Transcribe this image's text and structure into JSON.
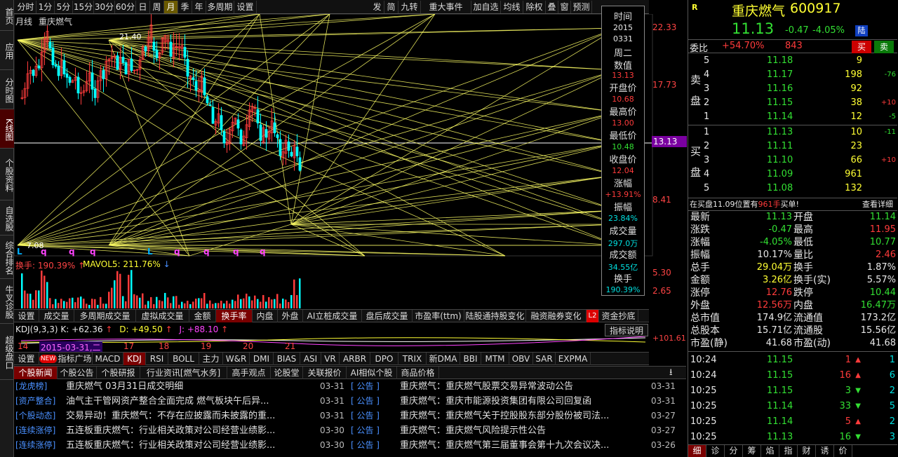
{
  "colors": {
    "up": "#ff3b3b",
    "down": "#33e033",
    "up_candle": "#ff3b3b",
    "down_candle": "#00ffff",
    "gann": "#ffff66",
    "accent": "#ffff33"
  },
  "left_tabs": [
    "首页",
    "应用",
    "分时图",
    "K线图",
    "个股资料",
    "自选股",
    "综合排名",
    "牛叉诊股",
    "超级盘口"
  ],
  "toolbar": {
    "periods": [
      "分时",
      "1分",
      "5分",
      "15分",
      "30分",
      "60分",
      "日",
      "周",
      "月",
      "季",
      "年",
      "多周期",
      "设置"
    ],
    "active_period": "月",
    "right_items": [
      "发",
      "简",
      "九转",
      "重大事件",
      "加自选",
      "均线",
      "除权",
      "叠",
      "窗",
      "预测"
    ]
  },
  "chart": {
    "period_label": "月线",
    "stock_label": "重庆燃气",
    "price_axis": [
      "22.33",
      "17.73",
      "13.13",
      "8.41"
    ],
    "current_price_tag": "13.13",
    "high_label": "21.40",
    "low_label": "7.08",
    "markers": [
      "L",
      "q",
      "q",
      "q",
      "L",
      "q",
      "q",
      "q",
      "q",
      "q",
      "q"
    ],
    "turnover_label": "换手: 190.39%",
    "mavol_label": "MAVOL5: 211.76%",
    "vol_axis": [
      "5.30",
      "2.65"
    ],
    "kdj_label": "KDJ(9,3,3)",
    "kdj_k": "K: +62.36",
    "kdj_d": "D: +49.50",
    "kdj_j": "J: +88.10",
    "kdj_axis_top": "+101.61",
    "date_labels": [
      "14",
      "2015-03-31,二",
      "17",
      "18",
      "19",
      "20",
      "21"
    ],
    "index_btn": "指标说明"
  },
  "infobox": {
    "time_label": "时间",
    "year": "2015",
    "date": "0331",
    "weekday": "周二",
    "value_label": "数值",
    "value": "13.13",
    "open_label": "开盘价",
    "open": "10.68",
    "high_label": "最高价",
    "high": "13.00",
    "low_label": "最低价",
    "low": "10.48",
    "close_label": "收盘价",
    "close": "12.04",
    "change_label": "涨幅",
    "change": "+13.91%",
    "amp_label": "振幅",
    "amp": "23.84%",
    "vol_label": "成交量",
    "vol": "297.0万",
    "amt_label": "成交额",
    "amt": "34.55亿",
    "turn_label": "换手",
    "turn": "190.39%"
  },
  "tabs1": [
    "设置",
    "成交量",
    "多周期成交量",
    "虚拟成交量",
    "金额",
    "换手率",
    "内盘",
    "外盘",
    "AI立桩成交量",
    "盘后成交量",
    "市盈率(ttm)",
    "陆股通持股变化",
    "融资融券变化",
    "L2",
    "资金抄底"
  ],
  "tabs1_active": "换手率",
  "tabs2": [
    "设置",
    "NEW",
    "指标广场",
    "MACD",
    "KDJ",
    "RSI",
    "BOLL",
    "主力",
    "W&R",
    "DMI",
    "BIAS",
    "ASI",
    "VR",
    "ARBR",
    "DPO",
    "TRIX",
    "新DMA",
    "BBI",
    "MTM",
    "OBV",
    "SAR",
    "EXPMA"
  ],
  "tabs2_active": "KDJ",
  "tabs3": [
    "个股新闻",
    "个股公告",
    "个股研报",
    "行业资讯[燃气水务]",
    "高手观点",
    "论股堂",
    "关联报价",
    "AI相似个股",
    "商品价格"
  ],
  "tabs3_active": "个股新闻",
  "news": [
    {
      "tag": "[龙虎榜]",
      "title": "重庆燃气 03月31日成交明细",
      "date": "03-31"
    },
    {
      "tag": "[资产整合]",
      "title": "油气主干管网资产整合全面完成 燃气板块午后异...",
      "date": "03-31"
    },
    {
      "tag": "[个股动态]",
      "title": "交易异动！重庆燃气：不存在应披露而未披露的重...",
      "date": "03-31"
    },
    {
      "tag": "[连续涨停]",
      "title": "五连板重庆燃气：行业相关政策对公司经营业绩影...",
      "date": "03-30"
    },
    {
      "tag": "[连续涨停]",
      "title": "五连板重庆燃气：行业相关政策对公司经营业绩影...",
      "date": "03-30"
    }
  ],
  "announcements": [
    {
      "tag": "[ 公告 ]",
      "title": "重庆燃气：重庆燃气股票交易异常波动公告",
      "date": "03-31"
    },
    {
      "tag": "[ 公告 ]",
      "title": "重庆燃气：重庆市能源投资集团有限公司回复函",
      "date": "03-31"
    },
    {
      "tag": "[ 公告 ]",
      "title": "重庆燃气：重庆燃气关于控股股东部分股份被司法...",
      "date": "03-27"
    },
    {
      "tag": "[ 公告 ]",
      "title": "重庆燃气：重庆燃气风险提示性公告",
      "date": "03-27"
    },
    {
      "tag": "[ 公告 ]",
      "title": "重庆燃气：重庆燃气第三届董事会第十九次会议决...",
      "date": "03-26"
    }
  ],
  "quote": {
    "badge": "R",
    "name": "重庆燃气",
    "code": "600917",
    "price": "11.13",
    "change": "-0.47",
    "change_pct": "-4.05%",
    "market": "陆",
    "weibi_label": "委比",
    "weibi": "+54.70%",
    "weicha": "843",
    "sell_btn": "买",
    "buy_btn": "卖",
    "sell_side_label": "卖盘",
    "buy_side_label": "买盘",
    "sell": [
      {
        "lvl": "5",
        "price": "11.18",
        "vol": "9",
        "chg": ""
      },
      {
        "lvl": "4",
        "price": "11.17",
        "vol": "198",
        "chg": "-76"
      },
      {
        "lvl": "3",
        "price": "11.16",
        "vol": "92",
        "chg": ""
      },
      {
        "lvl": "2",
        "price": "11.15",
        "vol": "38",
        "chg": "+10"
      },
      {
        "lvl": "1",
        "price": "11.14",
        "vol": "12",
        "chg": "-5"
      }
    ],
    "buy": [
      {
        "lvl": "1",
        "price": "11.13",
        "vol": "10",
        "chg": "-11"
      },
      {
        "lvl": "2",
        "price": "11.11",
        "vol": "23",
        "chg": ""
      },
      {
        "lvl": "3",
        "price": "11.10",
        "vol": "66",
        "chg": "+10"
      },
      {
        "lvl": "4",
        "price": "11.09",
        "vol": "961",
        "chg": ""
      },
      {
        "lvl": "5",
        "price": "11.08",
        "vol": "132",
        "chg": ""
      }
    ],
    "notice_prefix": "在买盘11.09位置有",
    "notice_vol": "961手",
    "notice_suffix": "买单!",
    "notice_link": "查看详细",
    "stats": [
      {
        "l1": "最新",
        "v1": "11.13",
        "c1": "green",
        "l2": "开盘",
        "v2": "11.14",
        "c2": "green"
      },
      {
        "l1": "涨跌",
        "v1": "-0.47",
        "c1": "green",
        "l2": "最高",
        "v2": "11.95",
        "c2": "red"
      },
      {
        "l1": "涨幅",
        "v1": "-4.05%",
        "c1": "green",
        "l2": "最低",
        "v2": "10.77",
        "c2": "green"
      },
      {
        "l1": "振幅",
        "v1": "10.17%",
        "c1": "white",
        "l2": "量比",
        "v2": "2.46",
        "c2": "red"
      },
      {
        "l1": "总手",
        "v1": "29.04万",
        "c1": "yellow",
        "l2": "换手",
        "v2": "1.87%",
        "c2": "white"
      },
      {
        "l1": "金额",
        "v1": "3.26亿",
        "c1": "yellow",
        "l2": "换手(实)",
        "v2": "5.57%",
        "c2": "white"
      },
      {
        "l1": "涨停",
        "v1": "12.76",
        "c1": "red",
        "l2": "跌停",
        "v2": "10.44",
        "c2": "green"
      },
      {
        "l1": "外盘",
        "v1": "12.56万",
        "c1": "red",
        "l2": "内盘",
        "v2": "16.47万",
        "c2": "green"
      },
      {
        "l1": "总市值",
        "v1": "174.9亿",
        "c1": "white",
        "l2": "流通值",
        "v2": "173.2亿",
        "c2": "white"
      },
      {
        "l1": "总股本",
        "v1": "15.71亿",
        "c1": "white",
        "l2": "流通股",
        "v2": "15.56亿",
        "c2": "white"
      },
      {
        "l1": "市盈(静)",
        "v1": "41.68",
        "c1": "white",
        "l2": "市盈(动)",
        "v2": "41.68",
        "c2": "white"
      }
    ],
    "ticks": [
      {
        "time": "10:24",
        "price": "11.15",
        "vol": "1",
        "dir": "up",
        "n": "1"
      },
      {
        "time": "10:24",
        "price": "11.15",
        "vol": "16",
        "dir": "up",
        "n": "6"
      },
      {
        "time": "10:25",
        "price": "11.15",
        "vol": "3",
        "dir": "down",
        "n": "2"
      },
      {
        "time": "10:25",
        "price": "11.14",
        "vol": "33",
        "dir": "down",
        "n": "5"
      },
      {
        "time": "10:25",
        "price": "11.14",
        "vol": "5",
        "dir": "up",
        "n": "2"
      },
      {
        "time": "10:25",
        "price": "11.13",
        "vol": "16",
        "dir": "down",
        "n": "3"
      }
    ],
    "bottom_tabs": [
      "细",
      "诊",
      "分",
      "筹",
      "焰",
      "指",
      "财",
      "诱",
      "价"
    ]
  }
}
